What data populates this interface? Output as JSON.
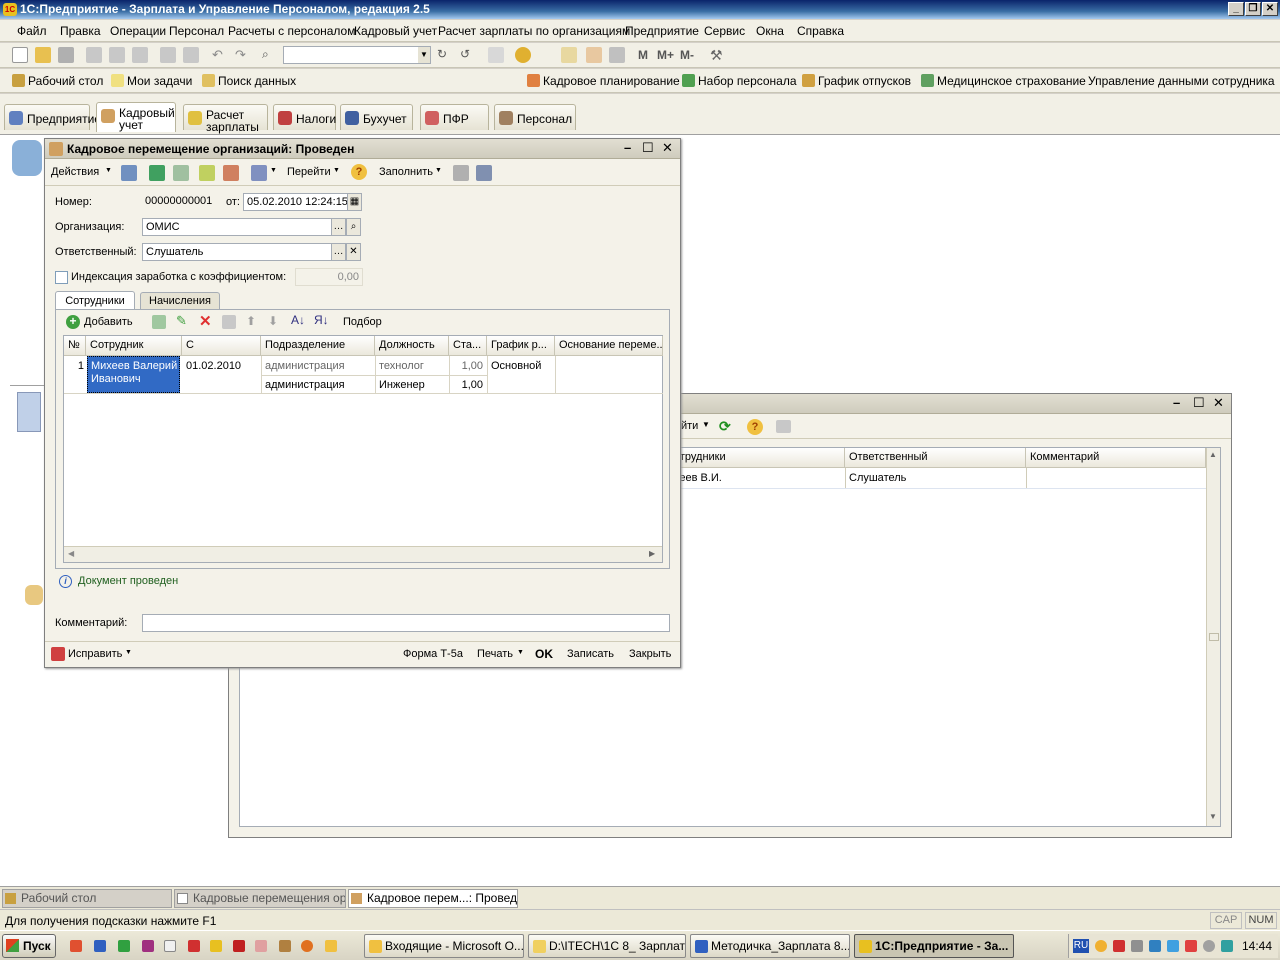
{
  "app": {
    "title": "1С:Предприятие - Зарплата и Управление Персоналом, редакция 2.5",
    "icon": "1c-icon"
  },
  "menu": [
    "Файл",
    "Правка",
    "Операции",
    "Персонал",
    "Расчеты с персоналом",
    "Кадровый учет",
    "Расчет зарплаты по организациям",
    "Предприятие",
    "Сервис",
    "Окна",
    "Справка"
  ],
  "toolbar1": {
    "mplus": "M",
    "mplus2": "M+",
    "mminus": "M-"
  },
  "toolbar2": {
    "desktop": "Рабочий стол",
    "tasks": "Мои задачи",
    "search": "Поиск данных",
    "hr_planning": "Кадровое планирование",
    "recruiting": "Набор персонала",
    "vacation": "График отпусков",
    "insurance": "Медицинское страхование",
    "employee_data": "Управление данными сотрудника"
  },
  "sections": {
    "enterprise": "Предприятие",
    "hr1": "Кадровый",
    "hr2": "учет",
    "payroll1": "Расчет",
    "payroll2": "зарплаты",
    "taxes": "Налоги",
    "accounting": "Бухучет",
    "pfr": "ПФР",
    "personnel": "Персонал"
  },
  "doc": {
    "title": "Кадровое перемещение организаций: Проведен",
    "actions": "Действия",
    "goto": "Перейти",
    "fill": "Заполнить",
    "number_label": "Номер:",
    "number": "00000000001",
    "date_label": "от:",
    "date": "05.02.2010 12:24:15",
    "org_label": "Организация:",
    "org": "ОМИС",
    "resp_label": "Ответственный:",
    "resp": "Слушатель",
    "index_label": "Индексация заработка с коэффициентом:",
    "index_value": "0,00",
    "tab_employees": "Сотрудники",
    "tab_accruals": "Начисления",
    "add": "Добавить",
    "select": "Подбор",
    "columns": [
      "№",
      "Сотрудник",
      "С",
      "Подразделение",
      "Должность",
      "Ста...",
      "График р...",
      "Основание переме..."
    ],
    "row": {
      "n": "1",
      "employee1": "Михеев Валерий",
      "employee2": "Иванович",
      "from": "01.02.2010",
      "dept_old": "администрация",
      "pos_old": "технолог",
      "rate_old": "1,00",
      "schedule": "Основной",
      "dept_new": "администрация",
      "pos_new": "Инженер",
      "rate_new": "1,00"
    },
    "status": "Документ проведен",
    "comment_label": "Комментарий:",
    "comment": "",
    "fix": "Исправить",
    "form": "Форма Т-5а",
    "print": "Печать",
    "ok": "OK",
    "save": "Записать",
    "close": "Закрыть"
  },
  "bg": {
    "goto": "йти",
    "columns": [
      "отрудники",
      "Ответственный",
      "Комментарий"
    ],
    "row": [
      "хеев В.И.",
      "Слушатель",
      ""
    ]
  },
  "windowtabs": [
    "Рабочий стол",
    "Кадровые перемещения ор...",
    "Кадровое перем...: Проведен"
  ],
  "statusbar": {
    "hint": "Для получения подсказки нажмите F1",
    "cap": "CAP",
    "num": "NUM"
  },
  "taskbar": {
    "start": "Пуск",
    "items": [
      "Входящие - Microsoft O...",
      "D:\\ITECH\\1C 8_ Зарплата",
      "Методичка_Зарплата 8...",
      "1С:Предприятие - За..."
    ],
    "lang": "RU",
    "time": "14:44"
  }
}
